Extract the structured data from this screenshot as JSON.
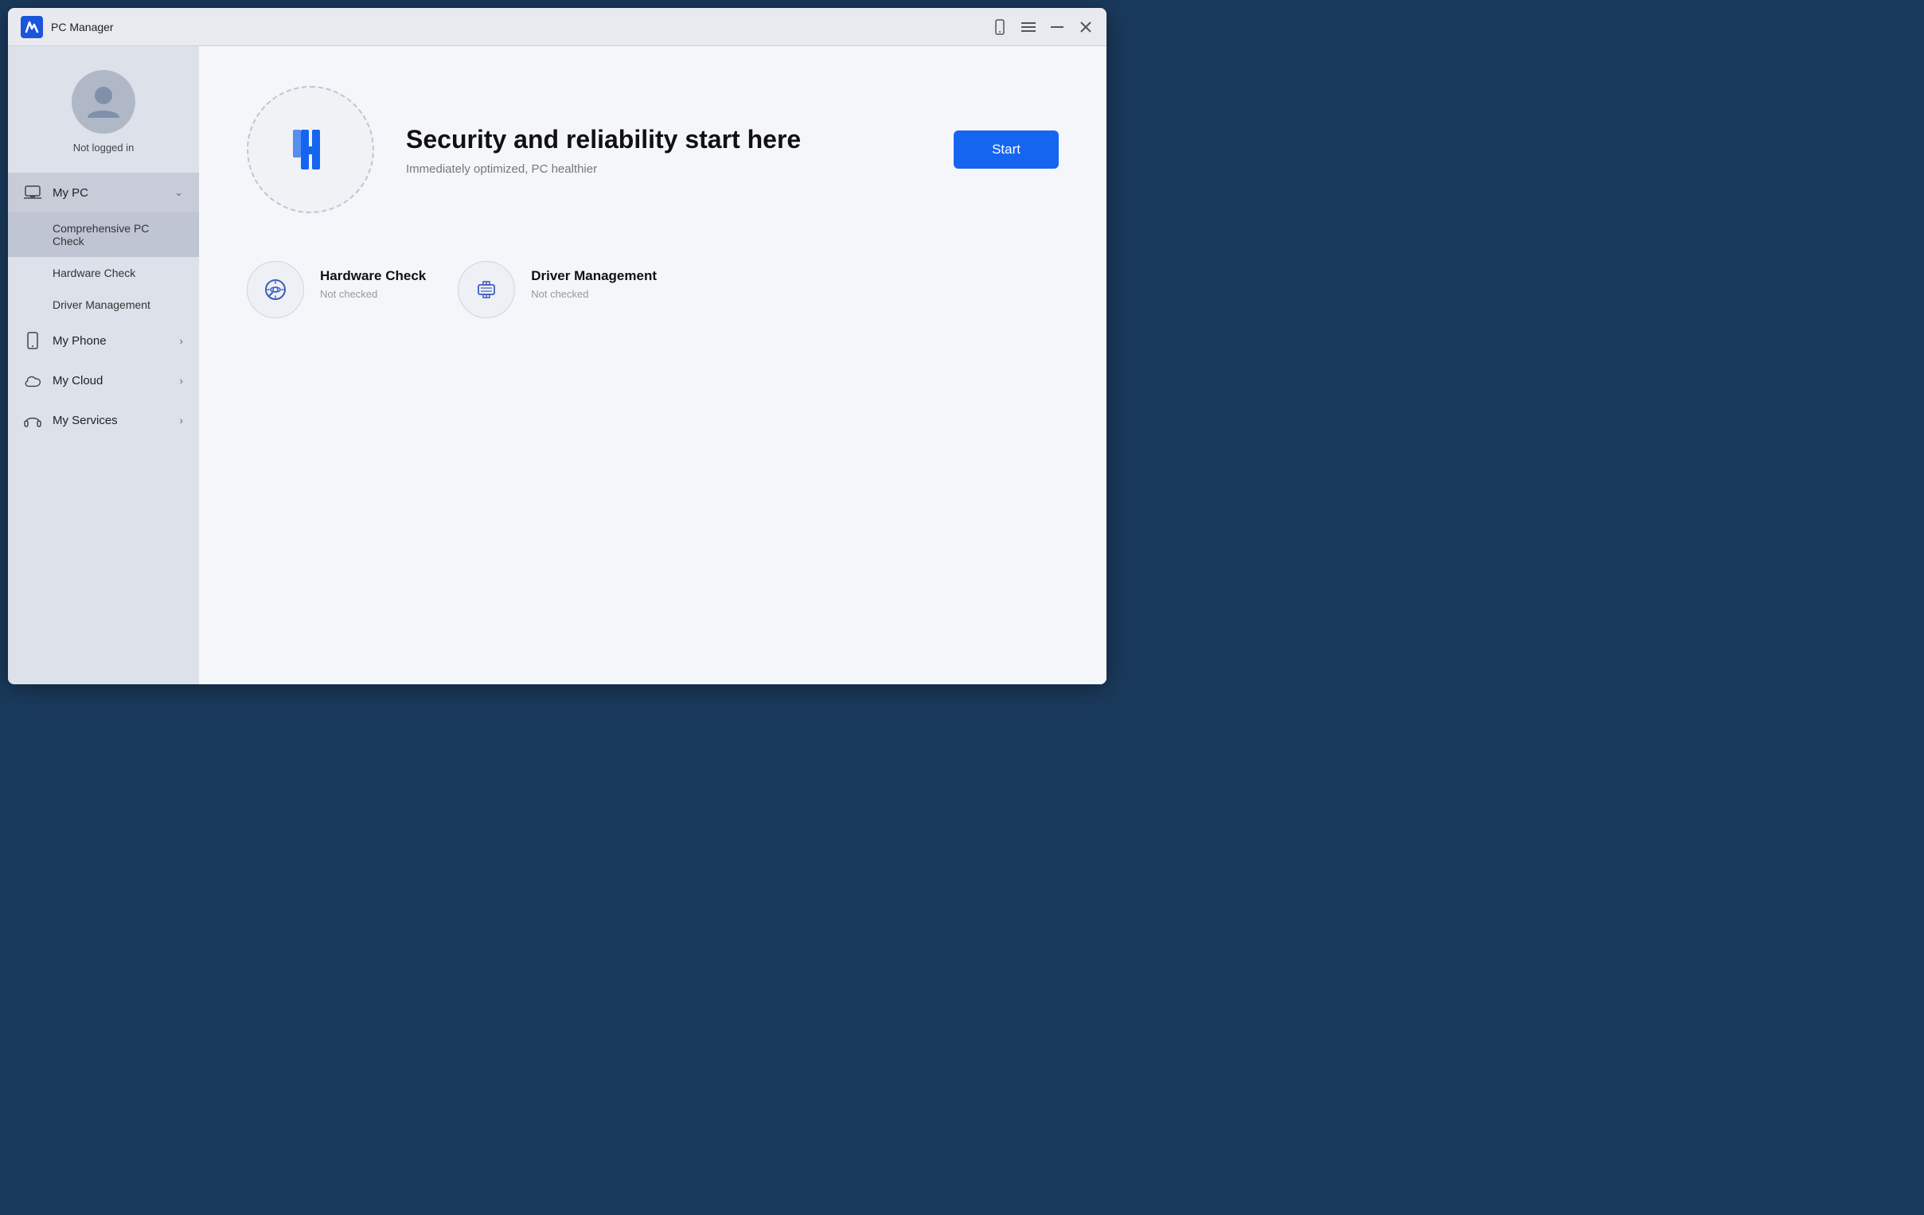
{
  "titleBar": {
    "appName": "PC Manager"
  },
  "sidebar": {
    "userStatus": "Not logged in",
    "navItems": [
      {
        "id": "my-pc",
        "label": "My PC",
        "hasChevron": true,
        "expanded": true,
        "icon": "laptop"
      },
      {
        "id": "my-phone",
        "label": "My Phone",
        "hasChevron": true,
        "expanded": false,
        "icon": "phone"
      },
      {
        "id": "my-cloud",
        "label": "My Cloud",
        "hasChevron": true,
        "expanded": false,
        "icon": "cloud"
      },
      {
        "id": "my-services",
        "label": "My Services",
        "hasChevron": true,
        "expanded": false,
        "icon": "headphone"
      }
    ],
    "subNavItems": [
      {
        "id": "comprehensive-pc-check",
        "label": "Comprehensive PC Check",
        "active": true
      },
      {
        "id": "hardware-check",
        "label": "Hardware Check",
        "active": false
      },
      {
        "id": "driver-management",
        "label": "Driver Management",
        "active": false
      }
    ]
  },
  "content": {
    "hero": {
      "title": "Security and reliability start here",
      "subtitle": "Immediately optimized, PC healthier",
      "startButton": "Start"
    },
    "cards": [
      {
        "id": "hardware-check",
        "title": "Hardware Check",
        "status": "Not checked",
        "icon": "hardware"
      },
      {
        "id": "driver-management",
        "title": "Driver Management",
        "status": "Not checked",
        "icon": "driver"
      }
    ]
  }
}
